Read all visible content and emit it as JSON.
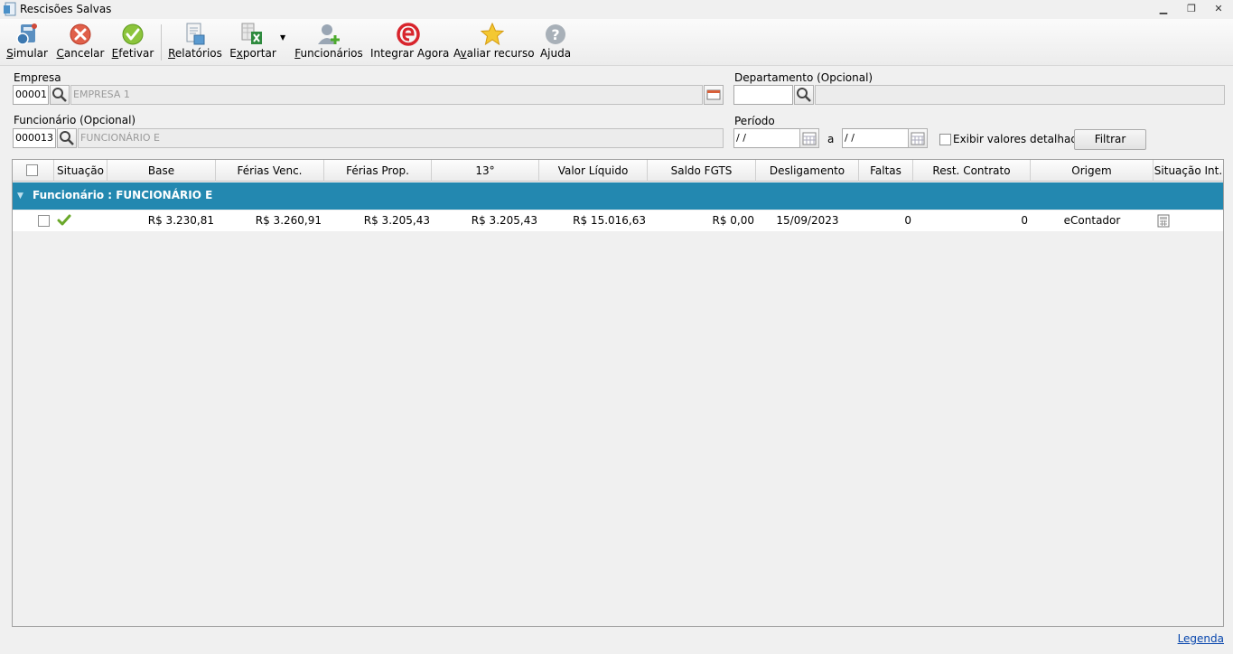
{
  "window": {
    "title": "Rescisões Salvas"
  },
  "toolbar": {
    "simular": "Simular",
    "simular_u": "S",
    "simular_rest": "imular",
    "cancelar_u": "C",
    "cancelar_rest": "ancelar",
    "efetivar_u": "E",
    "efetivar_rest": "fetivar",
    "relatorios_u": "R",
    "relatorios_rest": "elatórios",
    "exportar_pre": "E",
    "exportar_u": "x",
    "exportar_rest": "portar",
    "funcionarios_u": "F",
    "funcionarios_rest": "uncionários",
    "integrar": "Integrar Agora",
    "avaliar_pre": "A",
    "avaliar_u": "v",
    "avaliar_rest": "aliar recurso",
    "ajuda": "Ajuda"
  },
  "filters": {
    "empresa_label": "Empresa",
    "empresa_code": "00001",
    "empresa_name": "EMPRESA 1",
    "departamento_label": "Departamento (Opcional)",
    "departamento_code": "",
    "departamento_name": "",
    "funcionario_label": "Funcionário (Opcional)",
    "funcionario_code": "000013",
    "funcionario_name": "FUNCIONÁRIO E",
    "periodo_label": "Período",
    "periodo_from": " /  /",
    "periodo_sep": "a",
    "periodo_to": " /  /",
    "detalhados_label": "Exibir valores detalhados",
    "filtrar_label": "Filtrar"
  },
  "grid": {
    "columns": [
      "Situação",
      "Base",
      "Férias Venc.",
      "Férias Prop.",
      "13°",
      "Valor Líquido",
      "Saldo FGTS",
      "Desligamento",
      "Faltas",
      "Rest. Contrato",
      "Origem",
      "Situação Int."
    ],
    "group_label": "Funcionário : FUNCIONÁRIO E",
    "row": {
      "base": "R$ 3.230,81",
      "ferias_venc": "R$ 3.260,91",
      "ferias_prop": "R$ 3.205,43",
      "decimo": "R$ 3.205,43",
      "valor_liquido": "R$ 15.016,63",
      "saldo_fgts": "R$ 0,00",
      "desligamento": "15/09/2023",
      "faltas": "0",
      "rest_contrato": "0",
      "origem": "eContador"
    }
  },
  "footer": {
    "legenda": "Legenda"
  },
  "colors": {
    "group_bg": "#2388b0",
    "link": "#0645ad"
  }
}
